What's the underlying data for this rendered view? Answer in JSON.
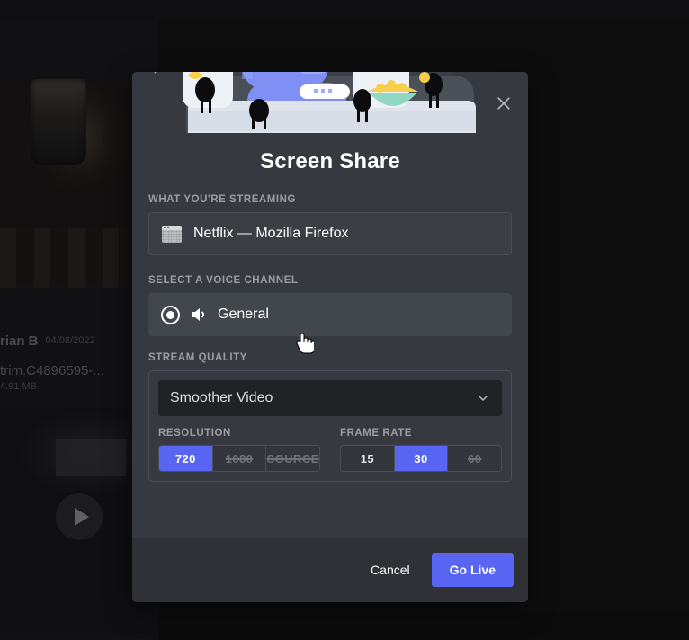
{
  "background": {
    "author": "rian B",
    "date": "04/08/2022",
    "attachment_name": "trim.C4896595-...",
    "attachment_size": "4.91 MB",
    "play_icon": "play-icon"
  },
  "modal": {
    "title": "Screen Share",
    "close_icon": "close-icon",
    "illustration": "wumpus-couch-movie-night-illustration",
    "streaming": {
      "label": "WHAT YOU'RE STREAMING",
      "source_icon": "window-icon",
      "source_name": "Netflix — Mozilla Firefox"
    },
    "voice_channel": {
      "label": "SELECT A VOICE CHANNEL",
      "radio_icon": "radio-selected-icon",
      "speaker_icon": "speaker-icon",
      "channel_name": "General",
      "selected": true
    },
    "stream_quality": {
      "label": "STREAM QUALITY",
      "preset_value": "Smoother Video",
      "chevron_icon": "chevron-down-icon",
      "resolution": {
        "label": "RESOLUTION",
        "options": [
          {
            "value": "720",
            "state": "active"
          },
          {
            "value": "1080",
            "state": "locked"
          },
          {
            "value": "SOURCE",
            "state": "locked"
          }
        ]
      },
      "frame_rate": {
        "label": "FRAME RATE",
        "options": [
          {
            "value": "15",
            "state": "normal"
          },
          {
            "value": "30",
            "state": "active"
          },
          {
            "value": "60",
            "state": "locked"
          }
        ]
      }
    },
    "footer": {
      "cancel_label": "Cancel",
      "golive_label": "Go Live"
    }
  },
  "colors": {
    "accent": "#5865f2",
    "modal_bg": "#36393f",
    "footer_bg": "#2f3136",
    "select_bg": "#202225",
    "label_text": "#9a9da3"
  }
}
